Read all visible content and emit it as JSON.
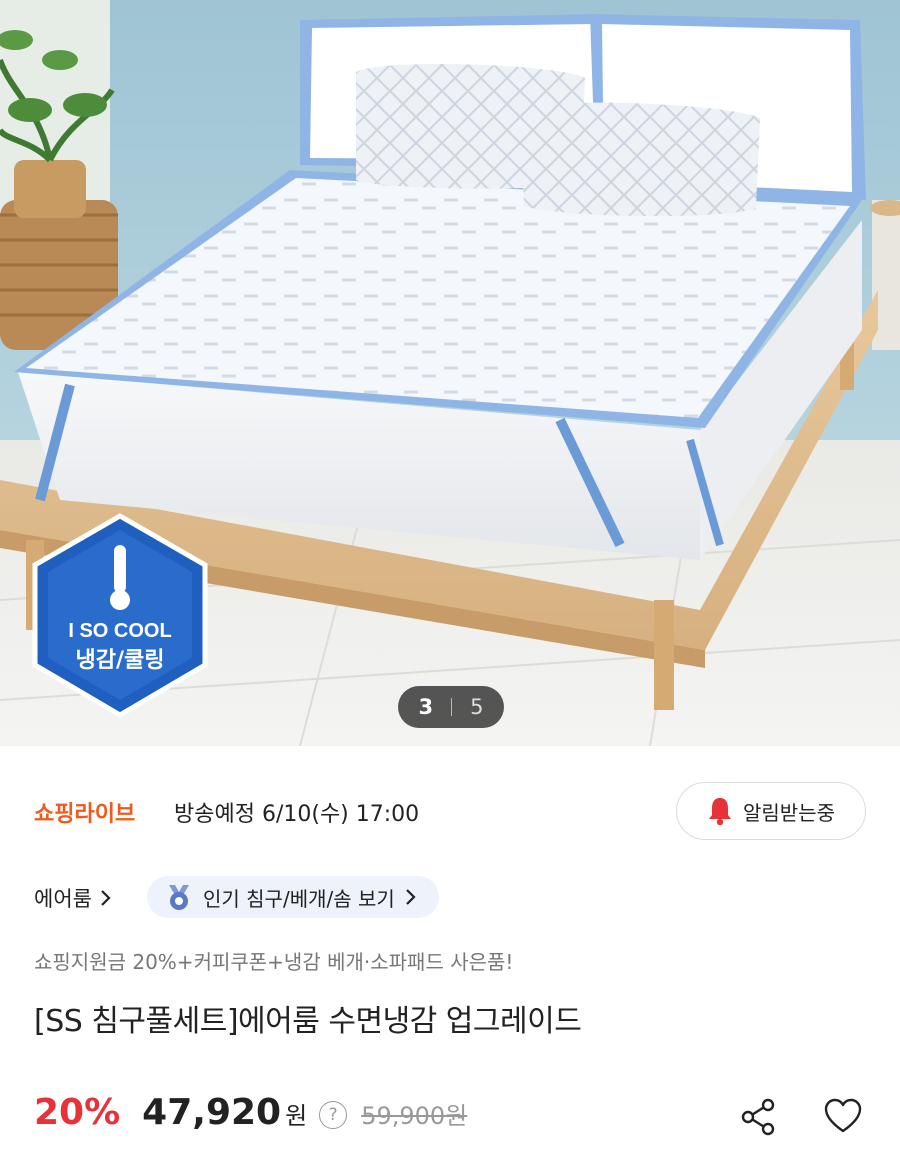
{
  "gallery": {
    "current": "3",
    "total": "5",
    "badge": {
      "line1": "I SO COOL",
      "line2": "냉감/쿨링"
    }
  },
  "live": {
    "brand": "쇼핑라이브",
    "schedule": "방송예정 6/10(수) 17:00",
    "alarm_label": "알림받는중",
    "alarm_color": "#e8323a"
  },
  "product": {
    "brand": "에어룸",
    "category_chip": "인기 침구/베개/솜 보기",
    "promo": "쇼핑지원금 20%+커피쿠폰+냉감 베개·소파패드 사은품!",
    "title": "[SS 침구풀세트]에어룸 수면냉감 업그레이드"
  },
  "price": {
    "discount": "20%",
    "sale": "47,920",
    "unit": "원",
    "help": "?",
    "original": "59,900원",
    "discount_color": "#e8323a"
  },
  "icons": {
    "share": "share-icon",
    "wish": "heart-icon",
    "alarm": "bell-icon",
    "chevron": "chevron-right-icon",
    "category": "medal-icon"
  }
}
